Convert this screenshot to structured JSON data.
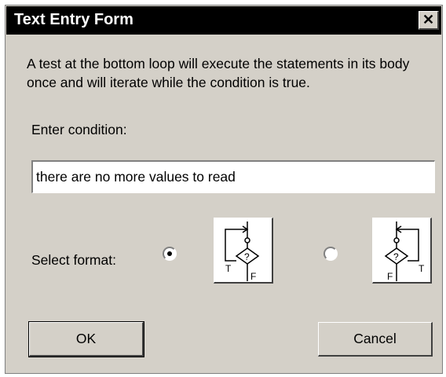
{
  "window": {
    "title": "Text Entry Form",
    "close_label": "✕"
  },
  "description": "A test at the bottom loop will execute the statements in its body once and will iterate while the condition is true.",
  "condition": {
    "label": "Enter condition:",
    "value": "there are no more values to read"
  },
  "format": {
    "label": "Select format:",
    "options": [
      {
        "selected": true,
        "true_label": "T",
        "false_label": "F",
        "decision_label": "?"
      },
      {
        "selected": false,
        "true_label": "T",
        "false_label": "F",
        "decision_label": "?"
      }
    ]
  },
  "buttons": {
    "ok": "OK",
    "cancel": "Cancel"
  }
}
